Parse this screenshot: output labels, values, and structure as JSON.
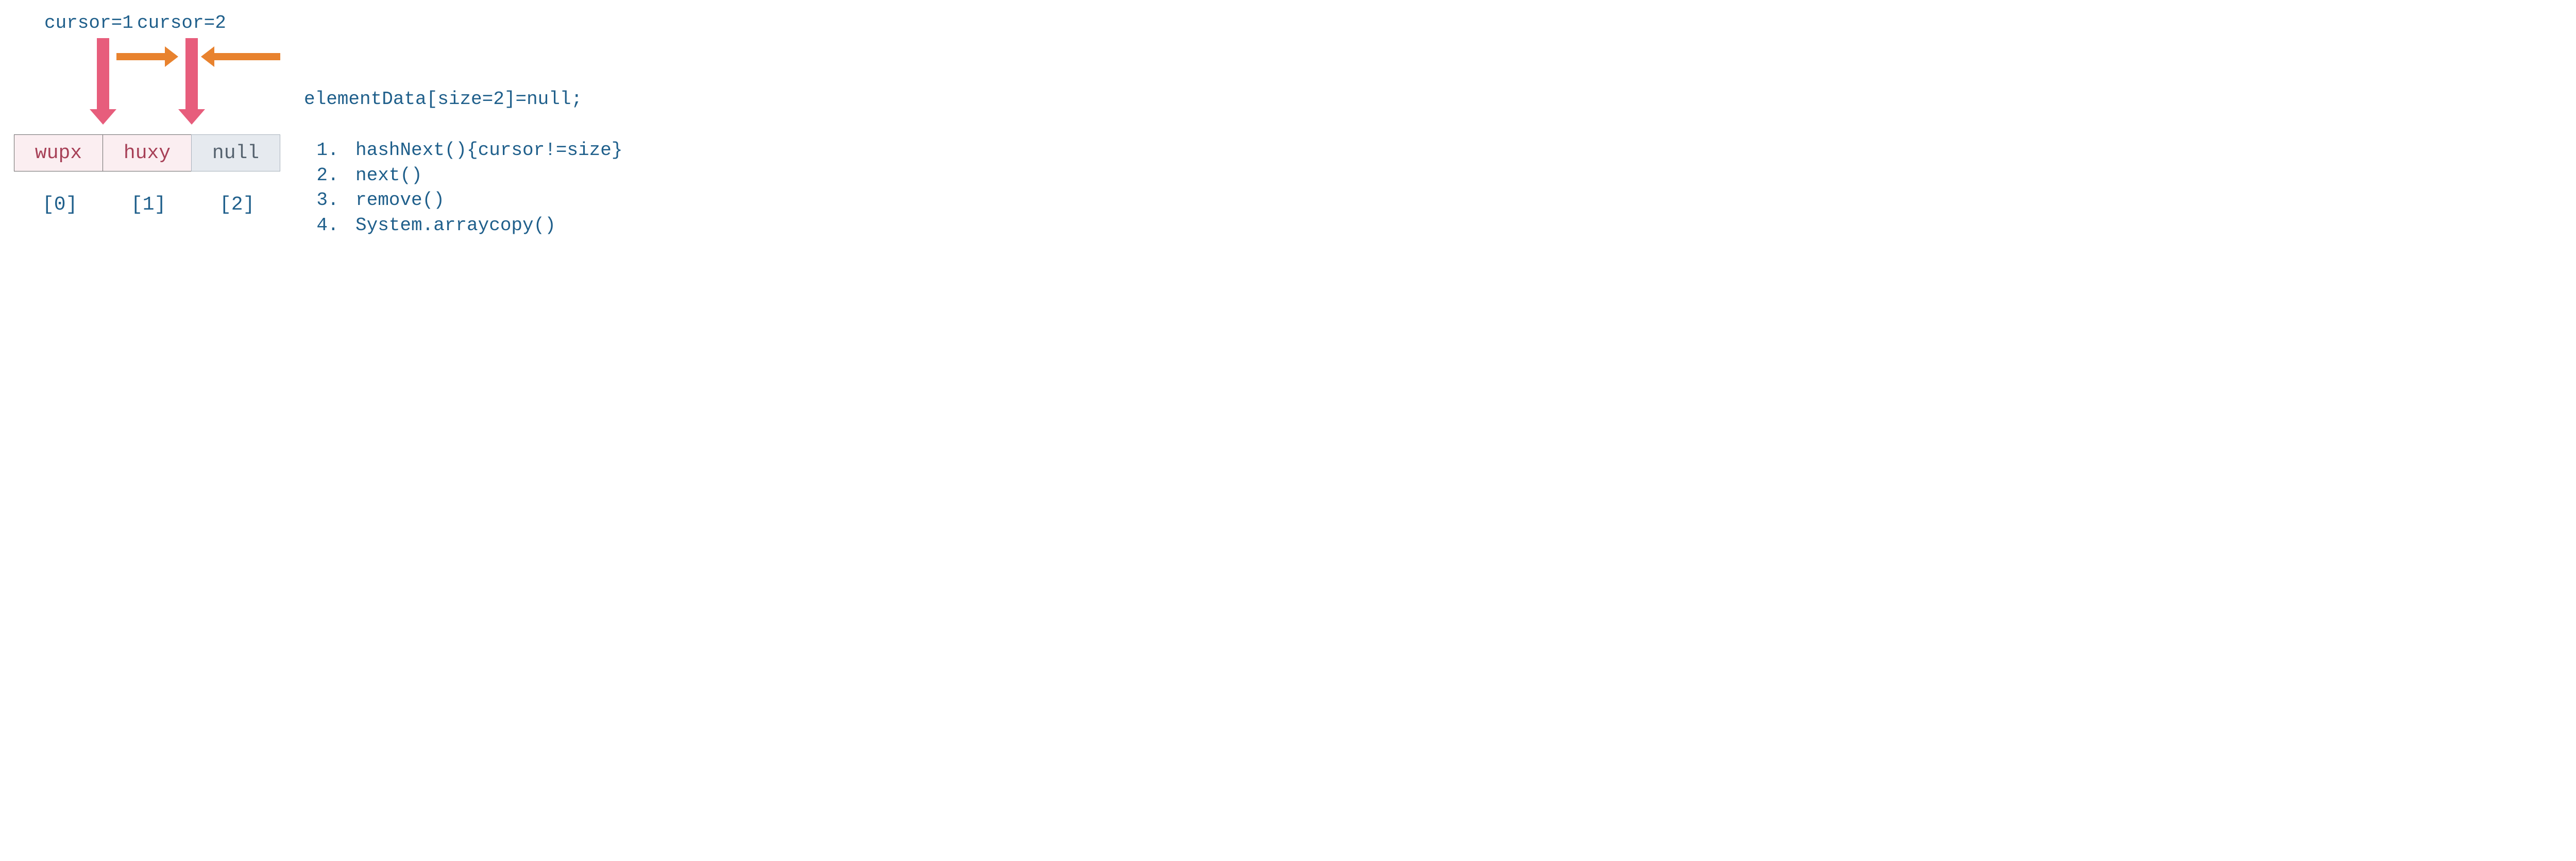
{
  "cursor_labels": {
    "c1": "cursor=1",
    "c2": "cursor=2"
  },
  "cells": {
    "v0": "wupx",
    "v1": "huxy",
    "v2": "null"
  },
  "indices": {
    "i0": "[0]",
    "i1": "[1]",
    "i2": "[2]"
  },
  "statement": "elementData[size=2]=null;",
  "steps": {
    "s1": "hashNext(){cursor!=size}",
    "s2": "next()",
    "s3": "remove()",
    "s4": "System.arraycopy()"
  },
  "colors": {
    "text_blue": "#1f5f8b",
    "pink_arrow": "#e75d7c",
    "orange_arrow": "#e8822e",
    "cell_pink_bg": "#fbeef1",
    "cell_pink_text": "#a74057",
    "cell_gray_bg": "#e6eaef",
    "cell_gray_text": "#55626e"
  },
  "chart_data": {
    "type": "table",
    "description": "Array diagram showing iterator cursor movement and element nullification",
    "array": [
      {
        "index": 0,
        "value": "wupx",
        "style": "active"
      },
      {
        "index": 1,
        "value": "huxy",
        "style": "active"
      },
      {
        "index": 2,
        "value": "null",
        "style": "nullified"
      }
    ],
    "cursors": [
      {
        "label": "cursor=1",
        "points_to_boundary_after_index": 0
      },
      {
        "label": "cursor=2",
        "points_to_boundary_after_index": 1
      }
    ],
    "horizontal_arrows": [
      {
        "from_boundary_after_index": 0,
        "to_boundary_after_index": 1,
        "direction": "right"
      },
      {
        "from": "right_side",
        "to_boundary_after_index": 1,
        "direction": "left"
      }
    ],
    "statement": "elementData[size=2]=null;",
    "steps": [
      "hashNext(){cursor!=size}",
      "next()",
      "remove()",
      "System.arraycopy()"
    ]
  }
}
